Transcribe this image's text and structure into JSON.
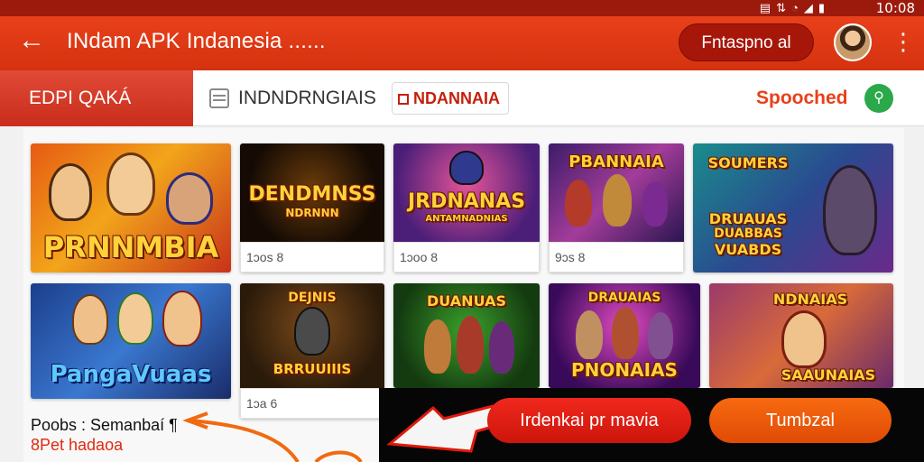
{
  "status": {
    "time": "10:08",
    "icons": [
      "vibrate-icon",
      "data-icon",
      "wifi-icon",
      "signal-icon",
      "battery-icon"
    ]
  },
  "app_bar": {
    "title": "INdam APK Indanesia ......",
    "pill_label": "Fntaspno al",
    "avatar_alt": "avatar"
  },
  "tabs": {
    "active": "EDPI QAKÁ",
    "second": "INDNDRNGIAIS",
    "third": "NDANNAIA",
    "right_link": "Spooched"
  },
  "colors": {
    "brand": "#e8401b",
    "brand_dark": "#9c1a0c",
    "accent_orange": "#f76a10",
    "search_green": "#2aa84a"
  },
  "cards": [
    {
      "title": "PRNNMBIA",
      "meta": ""
    },
    {
      "title": "DENDMNSS",
      "title_sub": "NDRNNN",
      "meta": "1ɔos 8"
    },
    {
      "title": "JRDNANAS",
      "title_sub": "ANTAMNADNIAS",
      "meta": "1ɔoo 8"
    },
    {
      "title": "PBANNAIA",
      "meta": "9ɔs 8"
    },
    {
      "title": "SOUMERS",
      "title_sub": "DRUAUAS",
      "title_sub2": "DUABBAS",
      "title_sub3": "VUABDS",
      "meta": ""
    },
    {
      "title": "PangaVuaas",
      "meta": ""
    },
    {
      "title": "DEJNIS",
      "title_sub": "BRRUUIIIS",
      "meta": "1ɔa 6"
    },
    {
      "title": "DUANUAS",
      "meta": ""
    },
    {
      "title": "DRAUAIAS",
      "title_sub": "PNONAIAS",
      "meta": ""
    },
    {
      "title": "NDNAIAS",
      "title_sub": "SAAUNAIAS",
      "meta": ""
    }
  ],
  "caption": {
    "line1": "Poobs : Semanbaí ¶",
    "line2": "8Pet hadaoa"
  },
  "actions": {
    "primary": "Irdenkai pr mavia",
    "secondary": "Tumbzal"
  }
}
